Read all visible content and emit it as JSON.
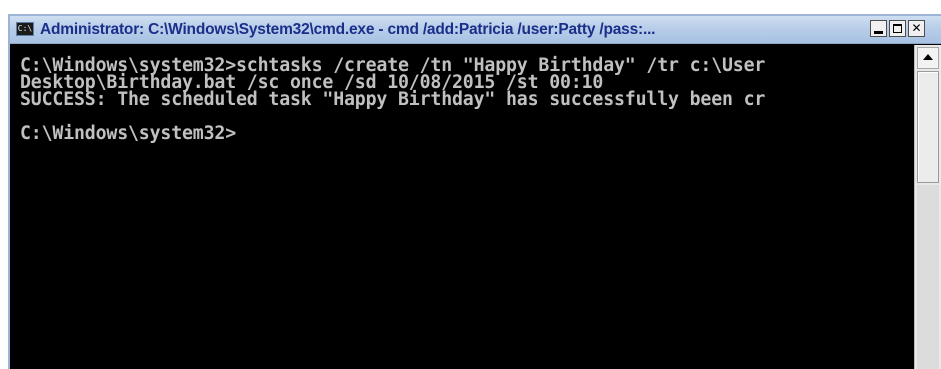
{
  "window": {
    "title": "Administrator: C:\\Windows\\System32\\cmd.exe - cmd  /add:Patricia /user:Patty /pass:...",
    "icon_label": "C:\\",
    "icon": "cmd-icon",
    "controls": {
      "minimize": "minimize-icon",
      "maximize": "maximize-icon",
      "close_label": "✕"
    }
  },
  "console": {
    "text": "C:\\Windows\\system32>schtasks /create /tn \"Happy Birthday\" /tr c:\\User\nDesktop\\Birthday.bat /sc once /sd 10/08/2015 /st 00:10\nSUCCESS: The scheduled task \"Happy Birthday\" has successfully been cr\n\nC:\\Windows\\system32>",
    "foreground": "#c0c0c0",
    "background": "#000000"
  },
  "colors": {
    "title_text": "#1a2f8a",
    "titlebar": "#b8cde8"
  }
}
